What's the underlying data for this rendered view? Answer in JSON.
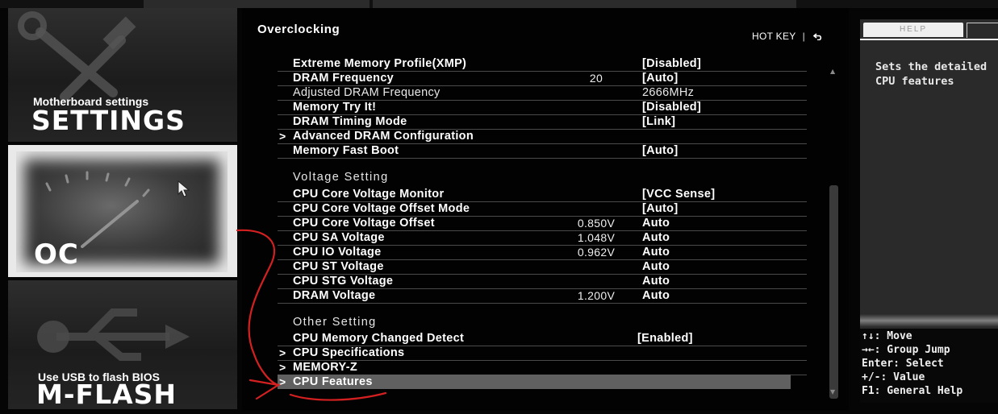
{
  "left_nav": {
    "settings": {
      "subtitle": "Motherboard settings",
      "title": "SETTINGS"
    },
    "oc": {
      "title": "OC"
    },
    "mflash": {
      "subtitle": "Use USB to flash BIOS",
      "title": "M-FLASH"
    }
  },
  "main": {
    "title": "Overclocking",
    "hotkey": {
      "label": "HOT KEY",
      "separator": "|",
      "back_icon": "back-arrow-icon"
    },
    "rows": [
      {
        "label": "Extreme Memory Profile(XMP)",
        "mid": "",
        "value": "[Disabled]"
      },
      {
        "label": "DRAM Frequency",
        "mid": "20",
        "value": "[Auto]"
      },
      {
        "label": "Adjusted DRAM Frequency",
        "mid": "",
        "value": "2666MHz"
      },
      {
        "label": "Memory Try It!",
        "mid": "",
        "value": "[Disabled]"
      },
      {
        "label": "DRAM Timing Mode",
        "mid": "",
        "value": "[Link]"
      },
      {
        "label": "Advanced DRAM Configuration",
        "mid": "",
        "value": ""
      },
      {
        "label": "Memory Fast Boot",
        "mid": "",
        "value": "[Auto]"
      },
      {
        "label": "CPU Core Voltage Monitor",
        "mid": "",
        "value": "[VCC Sense]"
      },
      {
        "label": "CPU Core Voltage Offset Mode",
        "mid": "",
        "value": "[Auto]"
      },
      {
        "label": "CPU Core Voltage Offset",
        "mid": "0.850V",
        "value": "Auto"
      },
      {
        "label": "CPU SA Voltage",
        "mid": "1.048V",
        "value": "Auto"
      },
      {
        "label": "CPU IO Voltage",
        "mid": "0.962V",
        "value": "Auto"
      },
      {
        "label": "CPU ST Voltage",
        "mid": "",
        "value": "Auto"
      },
      {
        "label": "CPU STG Voltage",
        "mid": "",
        "value": "Auto"
      },
      {
        "label": "DRAM Voltage",
        "mid": "1.200V",
        "value": "Auto"
      },
      {
        "label": "CPU Memory Changed Detect",
        "mid": "",
        "value": "[Enabled]"
      },
      {
        "label": "CPU Specifications",
        "mid": "",
        "value": ""
      },
      {
        "label": "MEMORY-Z",
        "mid": "",
        "value": ""
      },
      {
        "label": "CPU Features",
        "mid": "",
        "value": ""
      }
    ],
    "groups": {
      "voltage": "Voltage Setting",
      "other": "Other Setting"
    },
    "submenu_marker": ">"
  },
  "help": {
    "tab": "HELP",
    "text": "Sets the detailed\nCPU features",
    "keys": [
      "↑↓: Move",
      "→←: Group Jump",
      "Enter: Select",
      "+/-: Value",
      "F1: General Help"
    ]
  },
  "colors": {
    "background": "#050505",
    "selected_row": "#606060",
    "annotation": "#d42020"
  }
}
